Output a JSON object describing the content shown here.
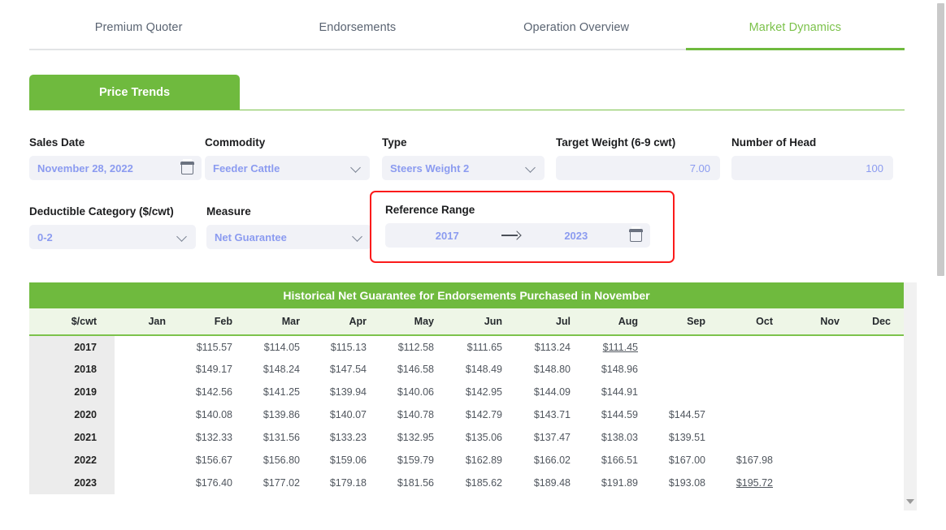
{
  "nav": {
    "tabs": [
      {
        "label": "Premium Quoter",
        "active": false
      },
      {
        "label": "Endorsements",
        "active": false
      },
      {
        "label": "Operation Overview",
        "active": false
      },
      {
        "label": "Market Dynamics",
        "active": true
      }
    ]
  },
  "subtabs": {
    "price_trends": "Price Trends"
  },
  "form": {
    "sales_date": {
      "label": "Sales Date",
      "value": "November 28, 2022",
      "icon": "calendar-icon"
    },
    "commodity": {
      "label": "Commodity",
      "value": "Feeder Cattle",
      "icon": "chevron-down-icon"
    },
    "type": {
      "label": "Type",
      "value": "Steers Weight 2",
      "icon": "chevron-down-icon"
    },
    "target_weight": {
      "label": "Target Weight (6-9 cwt)",
      "value": "7.00"
    },
    "number_of_head": {
      "label": "Number of Head",
      "value": "100"
    },
    "deductible_category": {
      "label": "Deductible Category ($/cwt)",
      "value": "0-2",
      "icon": "chevron-down-icon"
    },
    "measure": {
      "label": "Measure",
      "value": "Net Guarantee",
      "icon": "chevron-down-icon"
    },
    "reference_range": {
      "label": "Reference Range",
      "start": "2017",
      "end": "2023",
      "separator": "→",
      "icon": "calendar-icon",
      "highlight_color": "#fb1b1b"
    }
  },
  "table": {
    "title": "Historical Net Guarantee for Endorsements Purchased in November",
    "columns": [
      "$/cwt",
      "Jan",
      "Feb",
      "Mar",
      "Apr",
      "May",
      "Jun",
      "Jul",
      "Aug",
      "Sep",
      "Oct",
      "Nov",
      "Dec"
    ],
    "rows": [
      {
        "year": "2017",
        "cells": [
          "",
          "$115.57",
          "$114.05",
          "$115.13",
          "$112.58",
          "$111.65",
          "$113.24",
          "$111.45",
          "",
          "",
          "",
          ""
        ],
        "styles": [
          "",
          "red",
          "red",
          "red",
          "red",
          "red",
          "red",
          "red under",
          "",
          "",
          "",
          ""
        ]
      },
      {
        "year": "2018",
        "cells": [
          "",
          "$149.17",
          "$148.24",
          "$147.54",
          "$146.58",
          "$148.49",
          "$148.80",
          "$148.96",
          "",
          "",
          "",
          ""
        ],
        "styles": [
          "",
          "",
          "",
          "",
          "",
          "",
          "",
          "",
          "",
          "",
          "",
          ""
        ]
      },
      {
        "year": "2019",
        "cells": [
          "",
          "$142.56",
          "$141.25",
          "$139.94",
          "$140.06",
          "$142.95",
          "$144.09",
          "$144.91",
          "",
          "",
          "",
          ""
        ],
        "styles": [
          "",
          "",
          "",
          "",
          "",
          "",
          "",
          "",
          "",
          "",
          "",
          ""
        ]
      },
      {
        "year": "2020",
        "cells": [
          "",
          "$140.08",
          "$139.86",
          "$140.07",
          "$140.78",
          "$142.79",
          "$143.71",
          "$144.59",
          "$144.57",
          "",
          "",
          ""
        ],
        "styles": [
          "",
          "",
          "",
          "",
          "",
          "",
          "",
          "",
          "",
          "",
          "",
          ""
        ]
      },
      {
        "year": "2021",
        "cells": [
          "",
          "$132.33",
          "$131.56",
          "$133.23",
          "$132.95",
          "$135.06",
          "$137.47",
          "$138.03",
          "$139.51",
          "",
          "",
          ""
        ],
        "styles": [
          "",
          "",
          "",
          "",
          "",
          "",
          "",
          "",
          "red",
          "",
          "",
          ""
        ]
      },
      {
        "year": "2022",
        "cells": [
          "",
          "$156.67",
          "$156.80",
          "$159.06",
          "$159.79",
          "$162.89",
          "$166.02",
          "$166.51",
          "$167.00",
          "$167.98",
          "",
          ""
        ],
        "styles": [
          "",
          "",
          "",
          "",
          "",
          "",
          "",
          "",
          "",
          "red",
          "",
          ""
        ]
      },
      {
        "year": "2023",
        "cells": [
          "",
          "$176.40",
          "$177.02",
          "$179.18",
          "$181.56",
          "$185.62",
          "$189.48",
          "$191.89",
          "$193.08",
          "$195.72",
          "",
          ""
        ],
        "styles": [
          "",
          "green",
          "green",
          "green",
          "green",
          "green",
          "green",
          "green",
          "green",
          "green under",
          "",
          ""
        ]
      }
    ]
  },
  "colors": {
    "brand_green": "#6fba3e",
    "accent_green": "#7cc24b",
    "value_blue": "#8b9bf0",
    "negative_red": "#f8365c",
    "positive_green": "#63bd5b",
    "highlight_red": "#fb1b1b"
  },
  "scrollbars": {
    "table_scroll_icon": "chevron-down-icon",
    "page_scroll": "vertical-scrollbar"
  }
}
